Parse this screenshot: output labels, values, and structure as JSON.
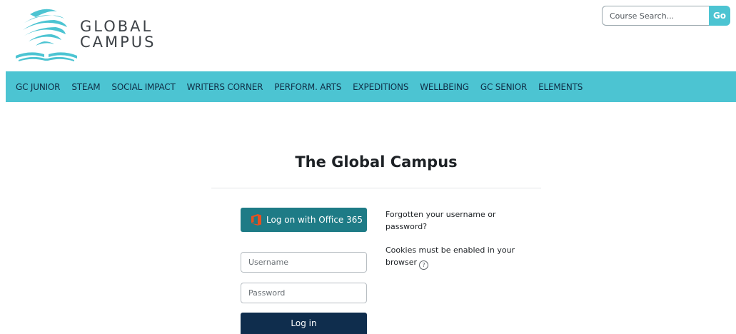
{
  "header": {
    "logo_line1": "GLOBAL",
    "logo_line2": "CAMPUS",
    "search_placeholder": "Course Search...",
    "search_button": "Go"
  },
  "nav": {
    "items": [
      "GC JUNIOR",
      "STEAM",
      "SOCIAL IMPACT",
      "WRITERS CORNER",
      "PERFORM. ARTS",
      "EXPEDITIONS",
      "WELLBEING",
      "GC SENIOR",
      "ELEMENTS"
    ]
  },
  "main": {
    "title": "The Global Campus",
    "office365_label": "Log on with Office 365",
    "username_placeholder": "Username",
    "password_placeholder": "Password",
    "login_label": "Log in",
    "forgot_link": "Forgotten your username or password?",
    "cookies_text": "Cookies must be enabled in your browser",
    "help_glyph": "?"
  },
  "icons": {
    "logo": "globe-book-logo",
    "office": "office-365-icon",
    "help": "question-circle-icon"
  },
  "colors": {
    "accent": "#4cc4d2",
    "office_button": "#1e7b86",
    "login_button": "#0f2d4d",
    "office_icon": "#e8501f"
  }
}
